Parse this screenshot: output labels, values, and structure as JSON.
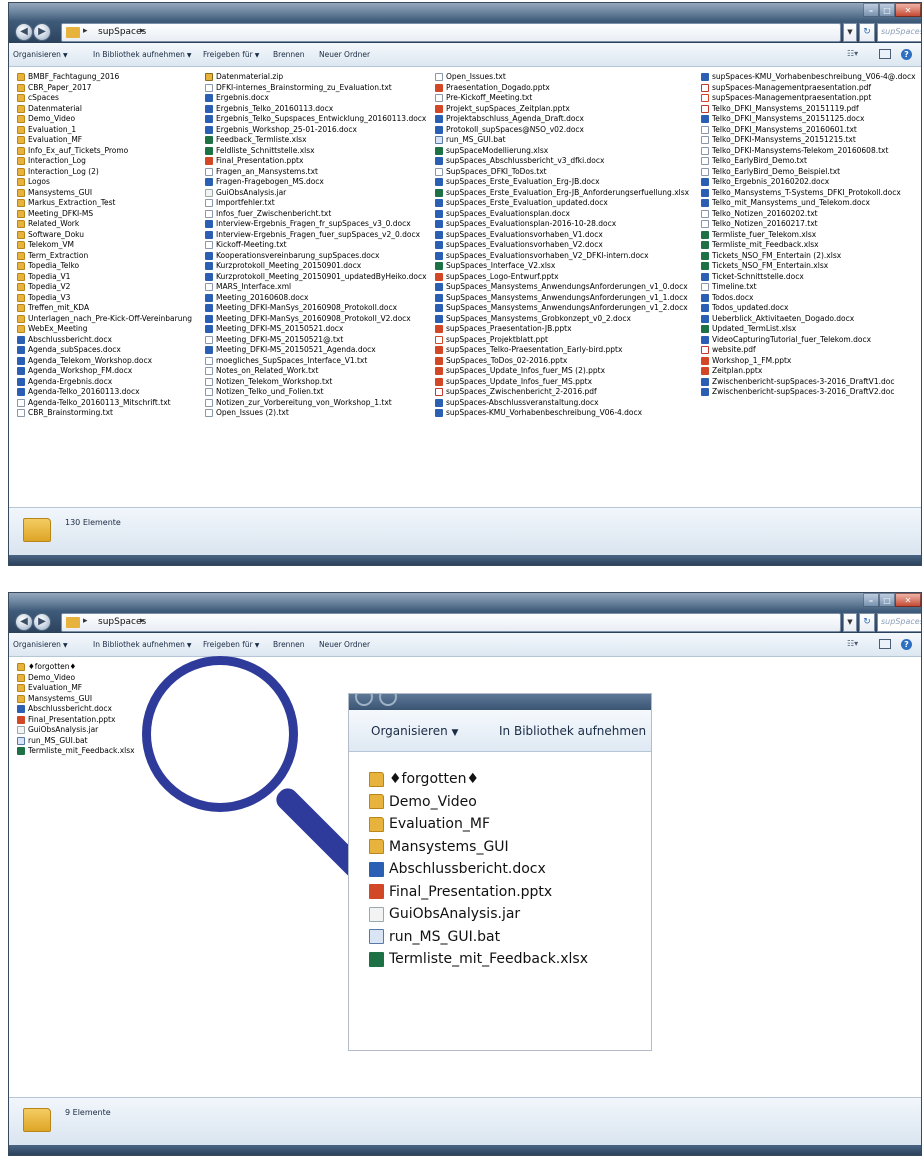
{
  "window1": {
    "path_segment": "supSpaces",
    "search_placeholder": "supSpaces...",
    "toolbar": {
      "organize": "Organisieren",
      "library": "In Bibliothek aufnehmen",
      "share": "Freigeben für",
      "burn": "Brennen",
      "new_folder": "Neuer Ordner"
    },
    "columns": [
      [
        {
          "name": "BMBF_Fachtagung_2016",
          "type": "folder"
        },
        {
          "name": "CBR_Paper_2017",
          "type": "folder"
        },
        {
          "name": "cSpaces",
          "type": "folder"
        },
        {
          "name": "Datenmaterial",
          "type": "folder"
        },
        {
          "name": "Demo_Video",
          "type": "folder"
        },
        {
          "name": "Evaluation_1",
          "type": "folder"
        },
        {
          "name": "Evaluation_MF",
          "type": "folder"
        },
        {
          "name": "Info_Ex_auf_Tickets_Promo",
          "type": "folder"
        },
        {
          "name": "Interaction_Log",
          "type": "folder"
        },
        {
          "name": "Interaction_Log (2)",
          "type": "folder"
        },
        {
          "name": "Logos",
          "type": "folder"
        },
        {
          "name": "Mansystems_GUI",
          "type": "folder"
        },
        {
          "name": "Markus_Extraction_Test",
          "type": "folder"
        },
        {
          "name": "Meeting_DFKI-MS",
          "type": "folder"
        },
        {
          "name": "Related_Work",
          "type": "folder"
        },
        {
          "name": "Software_Doku",
          "type": "folder"
        },
        {
          "name": "Telekom_VM",
          "type": "folder"
        },
        {
          "name": "Term_Extraction",
          "type": "folder"
        },
        {
          "name": "Topedia_Telko",
          "type": "folder"
        },
        {
          "name": "Topedia_V1",
          "type": "folder"
        },
        {
          "name": "Topedia_V2",
          "type": "folder"
        },
        {
          "name": "Topedia_V3",
          "type": "folder"
        },
        {
          "name": "Treffen_mit_KDA",
          "type": "folder"
        },
        {
          "name": "Unterlagen_nach_Pre-Kick-Off-Vereinbarung",
          "type": "folder"
        },
        {
          "name": "WebEx_Meeting",
          "type": "folder"
        },
        {
          "name": "Abschlussbericht.docx",
          "type": "docx"
        },
        {
          "name": "Agenda_subSpaces.docx",
          "type": "docx"
        },
        {
          "name": "Agenda_Telekom_Workshop.docx",
          "type": "docx"
        },
        {
          "name": "Agenda_Workshop_FM.docx",
          "type": "docx"
        },
        {
          "name": "Agenda-Ergebnis.docx",
          "type": "docx"
        },
        {
          "name": "Agenda-Telko_20160113.docx",
          "type": "docx"
        },
        {
          "name": "Agenda-Telko_20160113_Mitschrift.txt",
          "type": "txt"
        },
        {
          "name": "CBR_Brainstorming.txt",
          "type": "txt"
        }
      ],
      [
        {
          "name": "Datenmaterial.zip",
          "type": "zip"
        },
        {
          "name": "DFKI-internes_Brainstorming_zu_Evaluation.txt",
          "type": "txt"
        },
        {
          "name": "Ergebnis.docx",
          "type": "docx"
        },
        {
          "name": "Ergebnis_Telko_20160113.docx",
          "type": "docx"
        },
        {
          "name": "Ergebnis_Telko_Supspaces_Entwicklung_20160113.docx",
          "type": "docx"
        },
        {
          "name": "Ergebnis_Workshop_25-01-2016.docx",
          "type": "docx"
        },
        {
          "name": "Feedback_Termliste.xlsx",
          "type": "xlsx"
        },
        {
          "name": "Feldliste_Schnittstelle.xlsx",
          "type": "xlsx"
        },
        {
          "name": "Final_Presentation.pptx",
          "type": "pptx"
        },
        {
          "name": "Fragen_an_Mansystems.txt",
          "type": "txt"
        },
        {
          "name": "Fragen-Fragebogen_MS.docx",
          "type": "docx"
        },
        {
          "name": "GuiObsAnalysis.jar",
          "type": "jar"
        },
        {
          "name": "Importfehler.txt",
          "type": "txt"
        },
        {
          "name": "Infos_fuer_Zwischenbericht.txt",
          "type": "txt"
        },
        {
          "name": "Interview-Ergebnis_Fragen_fr_supSpaces_v3_0.docx",
          "type": "docx"
        },
        {
          "name": "Interview-Ergebnis_Fragen_fuer_supSpaces_v2_0.docx",
          "type": "docx"
        },
        {
          "name": "Kickoff-Meeting.txt",
          "type": "txt"
        },
        {
          "name": "Kooperationsvereinbarung_supSpaces.docx",
          "type": "docx"
        },
        {
          "name": "Kurzprotokoll_Meeting_20150901.docx",
          "type": "docx"
        },
        {
          "name": "Kurzprotokoll_Meeting_20150901_updatedByHeiko.docx",
          "type": "docx"
        },
        {
          "name": "MARS_Interface.xml",
          "type": "xml"
        },
        {
          "name": "Meeting_20160608.docx",
          "type": "docx"
        },
        {
          "name": "Meeting_DFKI-ManSys_20160908_Protokoll.docx",
          "type": "docx"
        },
        {
          "name": "Meeting_DFKI-ManSys_20160908_Protokoll_V2.docx",
          "type": "docx"
        },
        {
          "name": "Meeting_DFKI-MS_20150521.docx",
          "type": "docx"
        },
        {
          "name": "Meeting_DFKI-MS_20150521@.txt",
          "type": "txt"
        },
        {
          "name": "Meeting_DFKI-MS_20150521_Agenda.docx",
          "type": "docx"
        },
        {
          "name": "moegliches_SupSpaces_Interface_V1.txt",
          "type": "txt"
        },
        {
          "name": "Notes_on_Related_Work.txt",
          "type": "txt"
        },
        {
          "name": "Notizen_Telekom_Workshop.txt",
          "type": "txt"
        },
        {
          "name": "Notizen_Telko_und_Folien.txt",
          "type": "txt"
        },
        {
          "name": "Notizen_zur_Vorbereitung_von_Workshop_1.txt",
          "type": "txt"
        },
        {
          "name": "Open_Issues (2).txt",
          "type": "txt"
        }
      ],
      [
        {
          "name": "Open_Issues.txt",
          "type": "txt"
        },
        {
          "name": "Praesentation_Dogado.pptx",
          "type": "pptx"
        },
        {
          "name": "Pre-Kickoff_Meeting.txt",
          "type": "txt"
        },
        {
          "name": "Projekt_supSpaces_Zeitplan.pptx",
          "type": "pptx"
        },
        {
          "name": "Projektabschluss_Agenda_Draft.docx",
          "type": "docx"
        },
        {
          "name": "Protokoll_supSpaces@NSO_v02.docx",
          "type": "docx"
        },
        {
          "name": "run_MS_GUI.bat",
          "type": "bat"
        },
        {
          "name": "supSpaceModellierung.xlsx",
          "type": "xlsx"
        },
        {
          "name": "supSpaces_Abschlussbericht_v3_dfki.docx",
          "type": "docx"
        },
        {
          "name": "SupSpaces_DFKI_ToDos.txt",
          "type": "txt"
        },
        {
          "name": "supSpaces_Erste_Evaluation_Erg-JB.docx",
          "type": "docx"
        },
        {
          "name": "supSpaces_Erste_Evaluation_Erg-JB_Anforderungserfuellung.xlsx",
          "type": "xlsx"
        },
        {
          "name": "supSpaces_Erste_Evaluation_updated.docx",
          "type": "docx"
        },
        {
          "name": "supSpaces_Evaluationsplan.docx",
          "type": "docx"
        },
        {
          "name": "supSpaces_Evaluationsplan-2016-10-28.docx",
          "type": "docx"
        },
        {
          "name": "supSpaces_Evaluationsvorhaben_V1.docx",
          "type": "docx"
        },
        {
          "name": "supSpaces_Evaluationsvorhaben_V2.docx",
          "type": "docx"
        },
        {
          "name": "supSpaces_Evaluationsvorhaben_V2_DFKI-intern.docx",
          "type": "docx"
        },
        {
          "name": "SupSpaces_Interface_V2.xlsx",
          "type": "xlsx"
        },
        {
          "name": "supSpaces_Logo-Entwurf.pptx",
          "type": "pptx"
        },
        {
          "name": "SupSpaces_Mansystems_AnwendungsAnforderungen_v1_0.docx",
          "type": "docx"
        },
        {
          "name": "SupSpaces_Mansystems_AnwendungsAnforderungen_v1_1.docx",
          "type": "docx"
        },
        {
          "name": "SupSpaces_Mansystems_AnwendungsAnforderungen_v1_2.docx",
          "type": "docx"
        },
        {
          "name": "SupSpaces_Mansystems_Grobkonzept_v0_2.docx",
          "type": "docx"
        },
        {
          "name": "supSpaces_Praesentation-JB.pptx",
          "type": "pptx"
        },
        {
          "name": "supSpaces_Projektblatt.ppt",
          "type": "ppt"
        },
        {
          "name": "supSpaces_Telko-Praesentation_Early-bird.pptx",
          "type": "pptx"
        },
        {
          "name": "SupSpaces_ToDos_02-2016.pptx",
          "type": "pptx"
        },
        {
          "name": "supSpaces_Update_Infos_fuer_MS (2).pptx",
          "type": "pptx"
        },
        {
          "name": "supSpaces_Update_Infos_fuer_MS.pptx",
          "type": "pptx"
        },
        {
          "name": "supSpaces_Zwischenbericht_2-2016.pdf",
          "type": "pdf"
        },
        {
          "name": "supSpaces-Abschlussveranstaltung.docx",
          "type": "docx"
        },
        {
          "name": "supSpaces-KMU_Vorhabenbeschreibung_V06-4.docx",
          "type": "docx"
        }
      ],
      [
        {
          "name": "supSpaces-KMU_Vorhabenbeschreibung_V06-4@.docx",
          "type": "docx"
        },
        {
          "name": "supSpaces-Managementpraesentation.pdf",
          "type": "pdf"
        },
        {
          "name": "supSpaces-Managementpraesentation.ppt",
          "type": "ppt"
        },
        {
          "name": "Telko_DFKI_Mansystems_20151119.pdf",
          "type": "pdf"
        },
        {
          "name": "Telko_DFKI_Mansystems_20151125.docx",
          "type": "docx"
        },
        {
          "name": "Telko_DFKI_Mansystems_20160601.txt",
          "type": "txt"
        },
        {
          "name": "Telko_DFKI-Mansystems_20151215.txt",
          "type": "txt"
        },
        {
          "name": "Telko_DFKI-Mansystems-Telekom_20160608.txt",
          "type": "txt"
        },
        {
          "name": "Telko_EarlyBird_Demo.txt",
          "type": "txt"
        },
        {
          "name": "Telko_EarlyBird_Demo_Beispiel.txt",
          "type": "txt"
        },
        {
          "name": "Telko_Ergebnis_20160202.docx",
          "type": "docx"
        },
        {
          "name": "Telko_Mansystems_T-Systems_DFKI_Protokoll.docx",
          "type": "docx"
        },
        {
          "name": "Telko_mit_Mansystems_und_Telekom.docx",
          "type": "docx"
        },
        {
          "name": "Telko_Notizen_20160202.txt",
          "type": "txt"
        },
        {
          "name": "Telko_Notizen_20160217.txt",
          "type": "txt"
        },
        {
          "name": "Termliste_fuer_Telekom.xlsx",
          "type": "xlsx"
        },
        {
          "name": "Termliste_mit_Feedback.xlsx",
          "type": "xlsx"
        },
        {
          "name": "Tickets_NSO_FM_Entertain (2).xlsx",
          "type": "xlsx"
        },
        {
          "name": "Tickets_NSO_FM_Entertain.xlsx",
          "type": "xlsx"
        },
        {
          "name": "Ticket-Schnittstelle.docx",
          "type": "docx"
        },
        {
          "name": "Timeline.txt",
          "type": "txt"
        },
        {
          "name": "Todos.docx",
          "type": "docx"
        },
        {
          "name": "Todos_updated.docx",
          "type": "docx"
        },
        {
          "name": "Ueberblick_Aktivitaeten_Dogado.docx",
          "type": "docx"
        },
        {
          "name": "Updated_TermList.xlsx",
          "type": "xlsx"
        },
        {
          "name": "VideoCapturingTutorial_fuer_Telekom.docx",
          "type": "docx"
        },
        {
          "name": "website.pdf",
          "type": "pdf"
        },
        {
          "name": "Workshop_1_FM.pptx",
          "type": "pptx"
        },
        {
          "name": "Zeitplan.pptx",
          "type": "pptx"
        },
        {
          "name": "Zwischenbericht-supSpaces-3-2016_DraftV1.doc",
          "type": "doc"
        },
        {
          "name": "Zwischenbericht-supSpaces-3-2016_DraftV2.doc",
          "type": "doc"
        }
      ]
    ],
    "status": "130 Elemente"
  },
  "window2": {
    "path_segment": "supSpaces",
    "search_placeholder": "supSpaces...",
    "toolbar": {
      "organize": "Organisieren",
      "library": "In Bibliothek aufnehmen",
      "share": "Freigeben für",
      "burn": "Brennen",
      "new_folder": "Neuer Ordner"
    },
    "files": [
      {
        "name": "♦forgotten♦",
        "type": "folder"
      },
      {
        "name": "Demo_Video",
        "type": "folder"
      },
      {
        "name": "Evaluation_MF",
        "type": "folder"
      },
      {
        "name": "Mansystems_GUI",
        "type": "folder"
      },
      {
        "name": "Abschlussbericht.docx",
        "type": "docx"
      },
      {
        "name": "Final_Presentation.pptx",
        "type": "pptx"
      },
      {
        "name": "GuiObsAnalysis.jar",
        "type": "jar"
      },
      {
        "name": "run_MS_GUI.bat",
        "type": "bat"
      },
      {
        "name": "Termliste_mit_Feedback.xlsx",
        "type": "xlsx"
      }
    ],
    "status": "9 Elemente"
  },
  "zoom": {
    "organize": "Organisieren",
    "library": "In Bibliothek aufnehmen"
  },
  "colors": {
    "titlebar": "#3f5b7a",
    "magnifier": "#2f3b9a",
    "folder": "#e8b33c"
  }
}
